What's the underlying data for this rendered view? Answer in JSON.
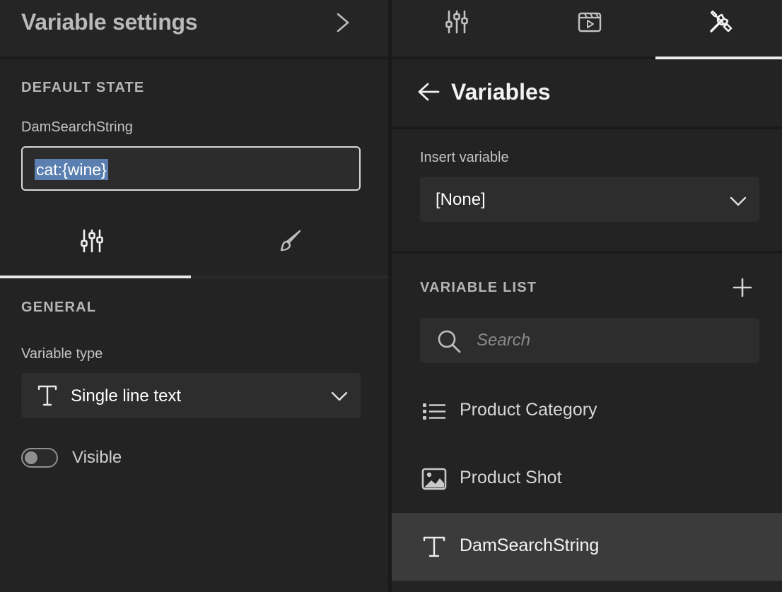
{
  "left_panel": {
    "title": "Variable settings",
    "default_state": {
      "section_label": "DEFAULT STATE",
      "variable_name": "DamSearchString",
      "value": "cat:{wine}"
    },
    "subtabs": [
      {
        "name": "properties",
        "icon": "sliders-icon",
        "active": true
      },
      {
        "name": "style",
        "icon": "paintbrush-icon",
        "active": false
      }
    ],
    "general": {
      "section_label": "GENERAL",
      "variable_type_label": "Variable type",
      "variable_type_value": "Single line text",
      "variable_type_icon": "text-type-icon",
      "visible_label": "Visible",
      "visible_on": false
    }
  },
  "right_panel": {
    "tabs": [
      {
        "name": "settings",
        "icon": "sliders-icon",
        "active": false
      },
      {
        "name": "animation",
        "icon": "clapperboard-icon",
        "active": false
      },
      {
        "name": "tools",
        "icon": "tools-icon",
        "active": true
      }
    ],
    "header": {
      "title": "Variables",
      "back_icon": "arrow-left-icon"
    },
    "insert_variable": {
      "label": "Insert variable",
      "value": "[None]"
    },
    "variable_list": {
      "section_label": "VARIABLE LIST",
      "add_icon": "plus-icon",
      "search_placeholder": "Search",
      "items": [
        {
          "label": "Product Category",
          "icon": "list-icon",
          "selected": false
        },
        {
          "label": "Product Shot",
          "icon": "image-icon",
          "selected": false
        },
        {
          "label": "DamSearchString",
          "icon": "text-type-icon",
          "selected": true
        }
      ]
    }
  },
  "colors": {
    "panel_bg": "#232323",
    "divider": "#1a1a1a",
    "selection_highlight": "#5a7fb0",
    "active_row": "#3b3b3b"
  }
}
